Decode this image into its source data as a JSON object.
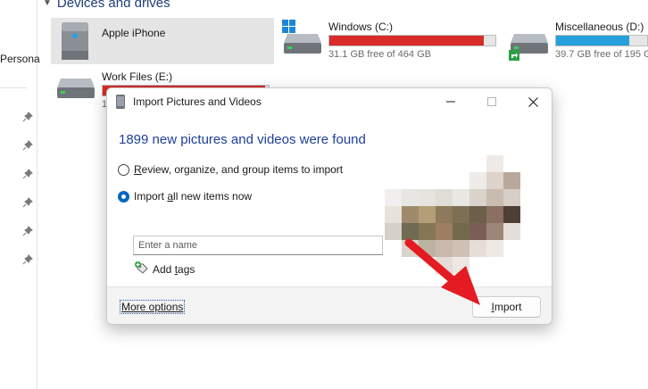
{
  "explorer": {
    "section_title": "Devices and drives",
    "nav_label": "Persona",
    "drives": [
      {
        "name": "Apple iPhone"
      },
      {
        "name": "Windows (C:)",
        "free": "31.1 GB free of 464 GB",
        "used_fraction": 0.93,
        "bar_color": "#da2a2a"
      },
      {
        "name": "Miscellaneous (D:)",
        "free": "39.7 GB free of 195 G",
        "used_fraction": 0.8,
        "bar_color": "#26a0da"
      },
      {
        "name": "Work Files (E:)",
        "free": "1",
        "used_fraction": 0.98,
        "bar_color": "#da2a2a"
      }
    ]
  },
  "dialog": {
    "title": "Import Pictures and Videos",
    "heading": "1899 new pictures and videos were found",
    "options": [
      {
        "label_pre": "",
        "label_key": "R",
        "label_post": "eview, organize, and group items to import",
        "checked": false
      },
      {
        "label_pre": "Import ",
        "label_key": "a",
        "label_post": "ll new items now",
        "checked": true
      }
    ],
    "name_placeholder": "Enter a name",
    "add_tags_pre": "Add ",
    "add_tags_key": "t",
    "add_tags_post": "ags",
    "more_options": "More options",
    "import_pre": "",
    "import_key": "I",
    "import_post": "mport"
  },
  "colors": {
    "accent": "#0067c0",
    "heading": "#1e3f9a",
    "arrow": "#e41b23"
  },
  "icons": {
    "minimize": "minimize-icon",
    "maximize": "maximize-icon",
    "close": "close-icon",
    "pin": "pin-icon",
    "drive": "drive-icon",
    "phone": "phone-icon",
    "tag": "tag-icon"
  }
}
